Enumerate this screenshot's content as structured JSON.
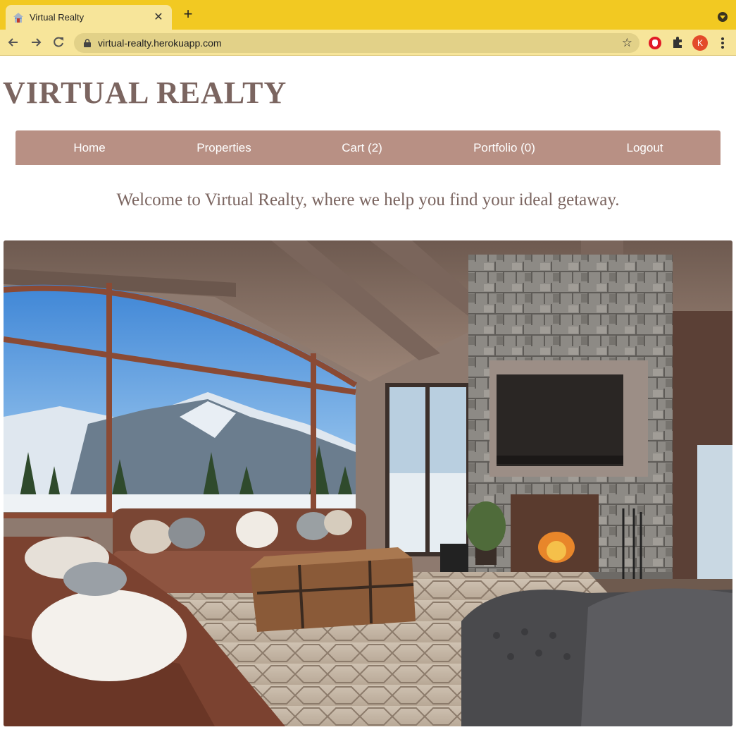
{
  "browser": {
    "tab_title": "Virtual Realty",
    "url": "virtual-realty.herokuapp.com",
    "profile_initial": "K",
    "accent_color": "#f2c922"
  },
  "site": {
    "title": "VIRTUAL REALTY",
    "welcome": "Welcome to Virtual Realty, where we help you find your ideal getaway.",
    "brand_color": "#7b6560",
    "nav_color": "#b89084"
  },
  "nav": {
    "home": "Home",
    "properties": "Properties",
    "cart": "Cart (2)",
    "portfolio": "Portfolio (0)",
    "logout": "Logout"
  },
  "hero": {
    "icon": "living-room-mountain-view-image"
  }
}
